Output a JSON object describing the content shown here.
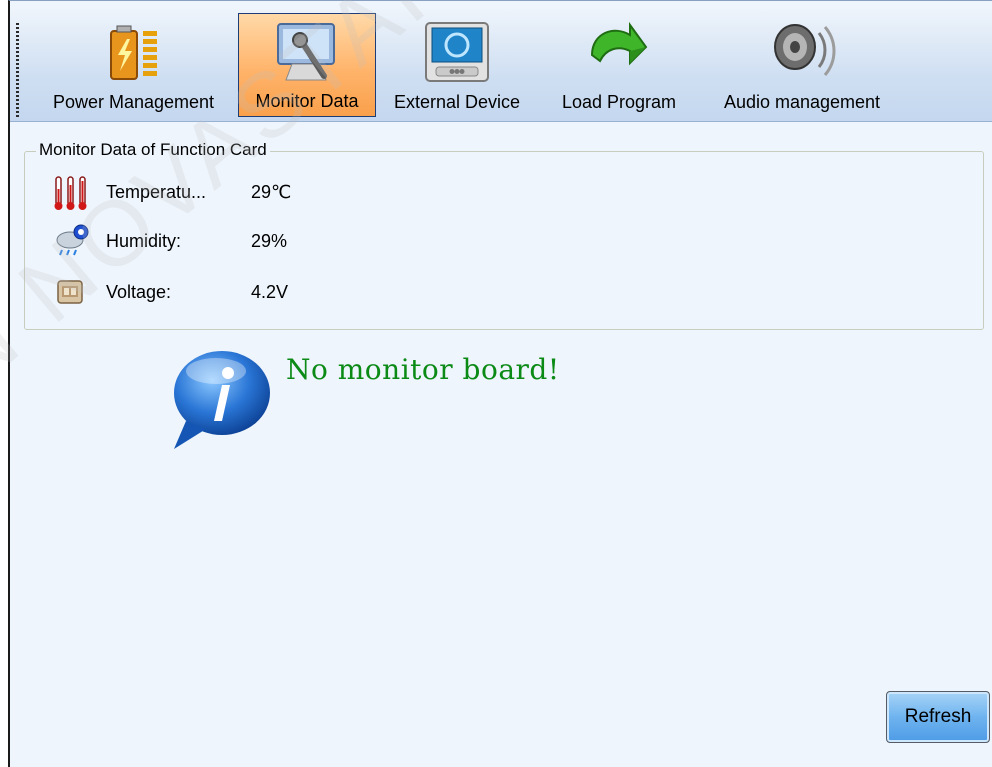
{
  "toolbar": {
    "items": [
      {
        "label": "Power Management",
        "icon": "battery-icon",
        "active": false
      },
      {
        "label": "Monitor Data",
        "icon": "monitor-data-icon",
        "active": true
      },
      {
        "label": "External Device",
        "icon": "external-device-icon",
        "active": false
      },
      {
        "label": "Load Program",
        "icon": "load-program-arrow-icon",
        "active": false
      },
      {
        "label": "Audio management",
        "icon": "speaker-icon",
        "active": false
      }
    ]
  },
  "monitor_group": {
    "title": "Monitor Data of Function Card",
    "rows": [
      {
        "label": "Temperatu...",
        "value": "29℃",
        "icon": "thermometer-icon"
      },
      {
        "label": "Humidity:",
        "value": "29%",
        "icon": "humidity-icon"
      },
      {
        "label": "Voltage:",
        "value": "4.2V",
        "icon": "voltage-icon"
      }
    ]
  },
  "message": {
    "text": "No monitor board!",
    "icon": "info-icon",
    "color": "#0c8a16"
  },
  "refresh_label": "Refresh",
  "watermark": "N NOVASTAR TECH",
  "colors": {
    "active_tab": "#ffb46b",
    "toolbar_bg": "#cfdff2",
    "panel_bg": "#eef5fc",
    "refresh_button": "#6fb4ef"
  }
}
